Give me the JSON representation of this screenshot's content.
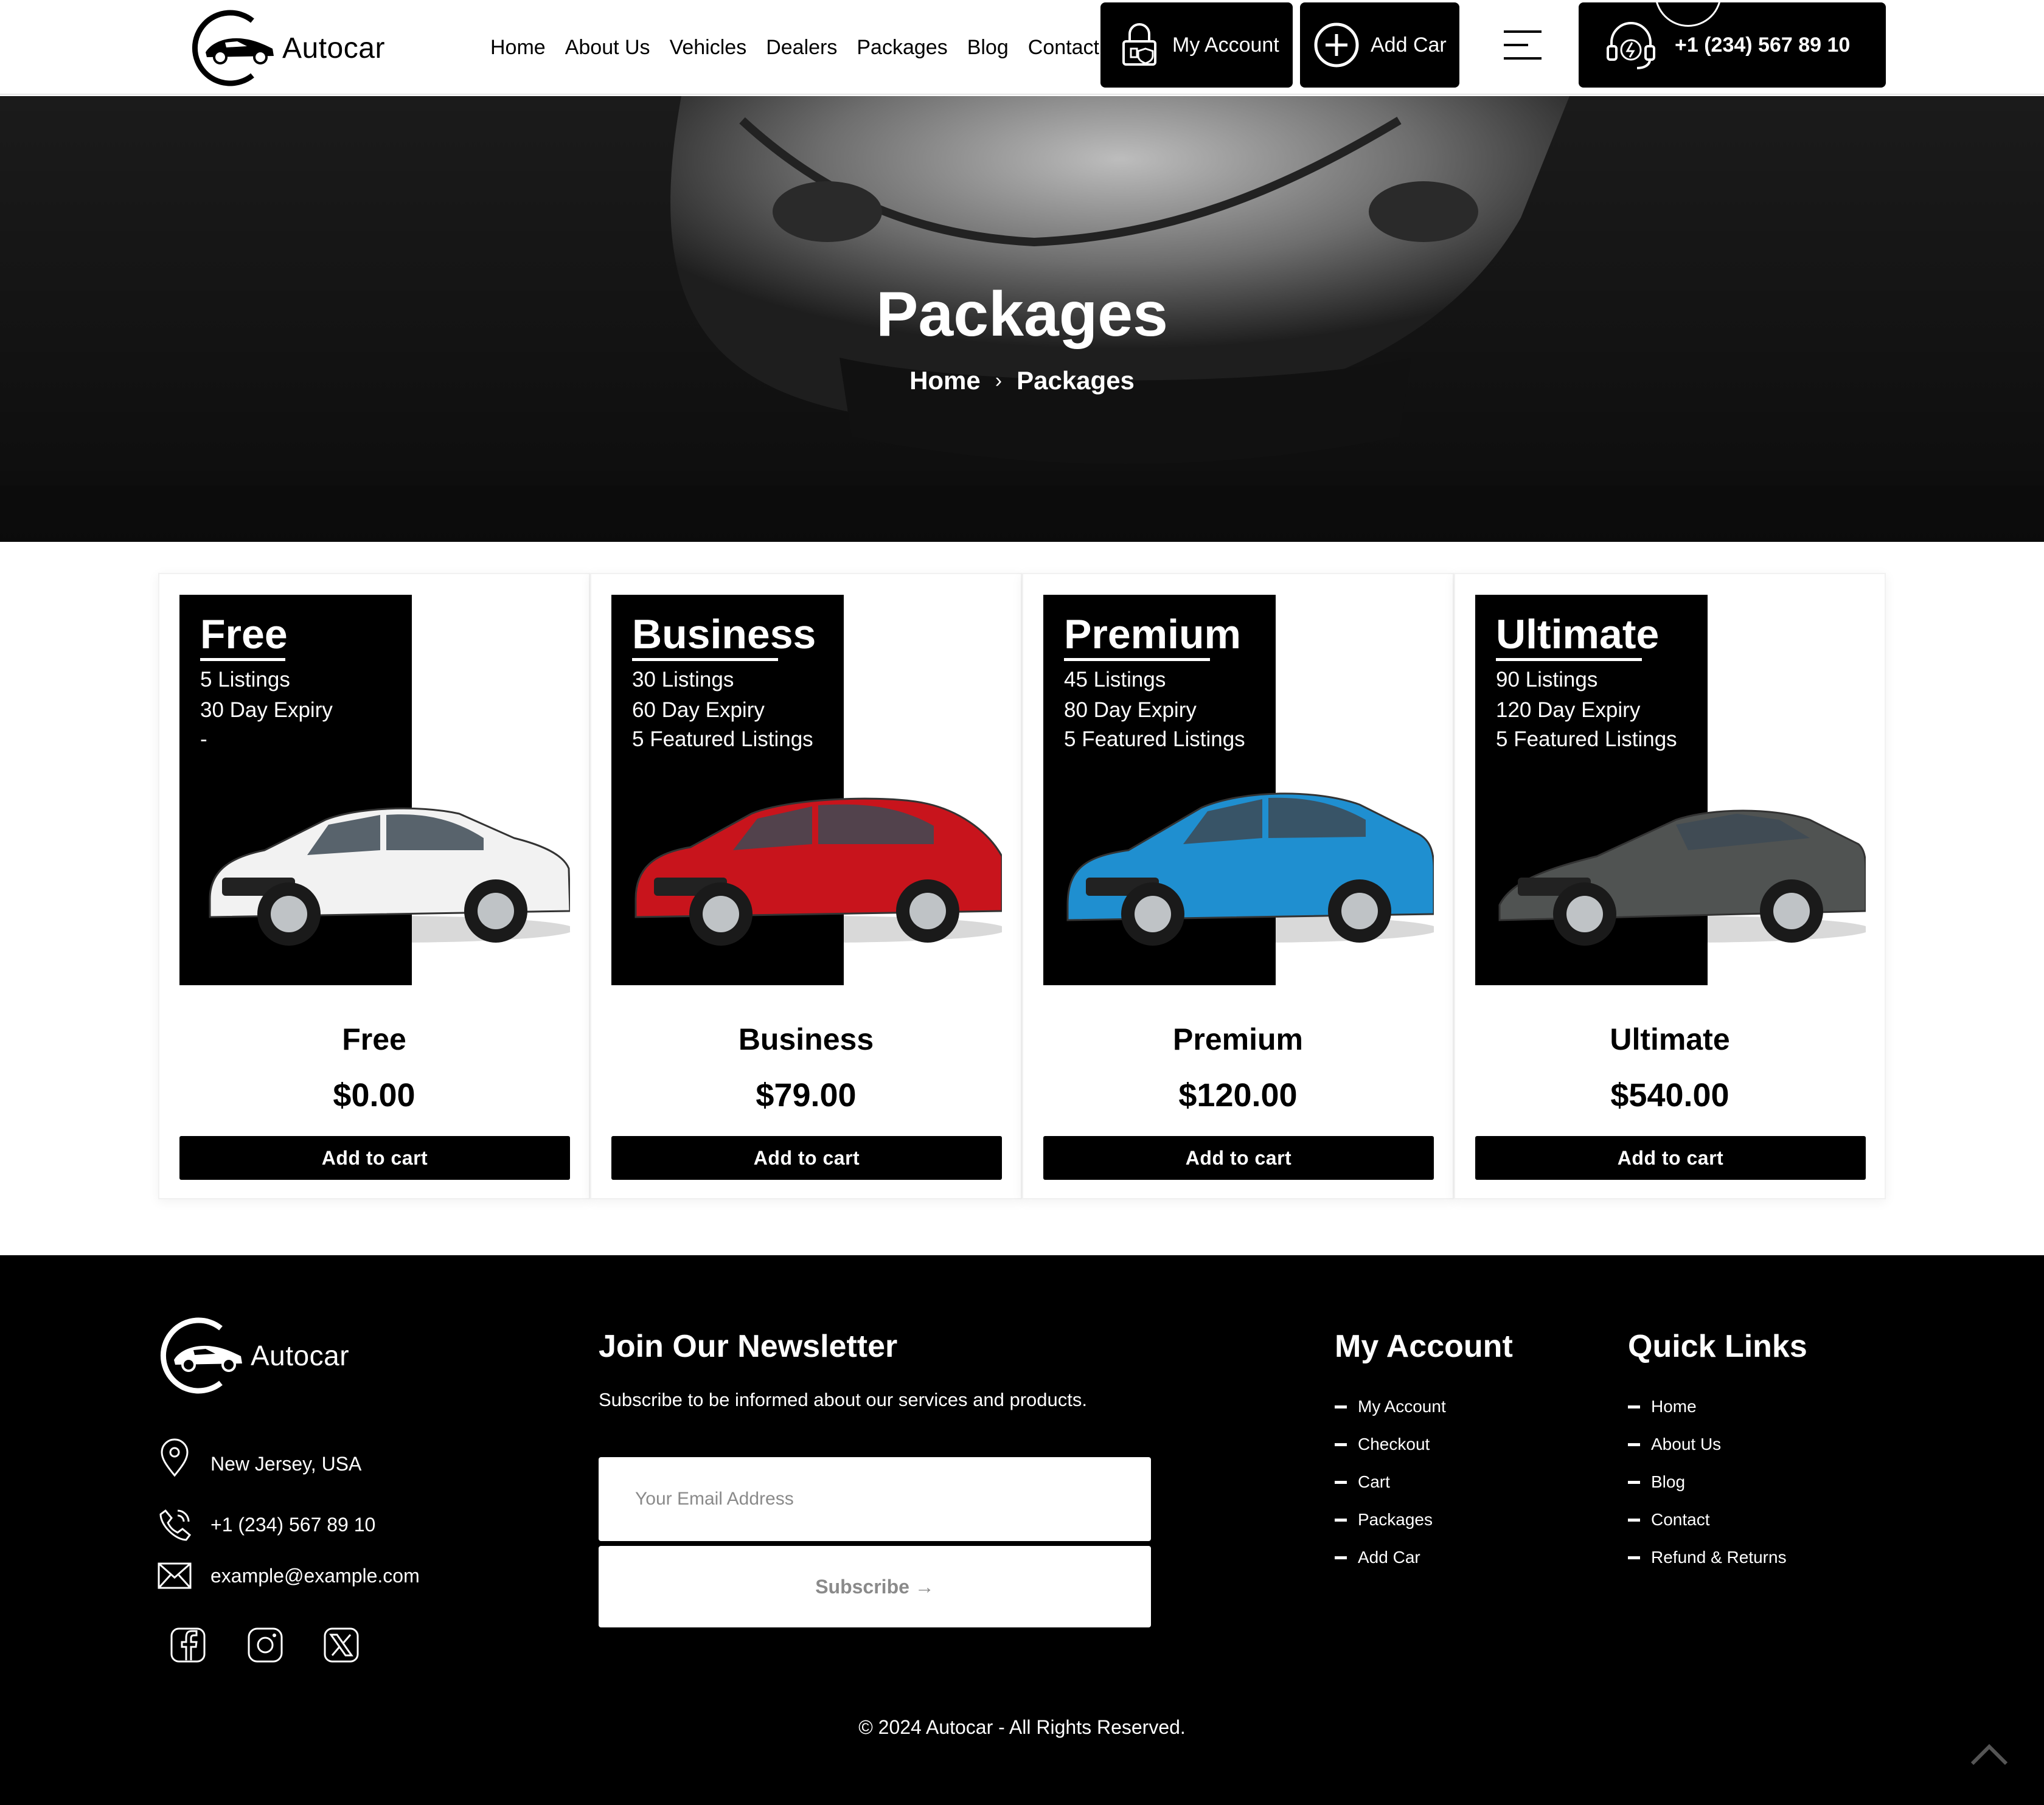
{
  "brand": {
    "name": "Autocar"
  },
  "nav": {
    "items": [
      "Home",
      "About Us",
      "Vehicles",
      "Dealers",
      "Packages",
      "Blog",
      "Contact"
    ],
    "account_label": "My Account",
    "add_car_label": "Add Car",
    "phone": "+1 (234) 567 89 10"
  },
  "hero": {
    "title": "Packages",
    "breadcrumb": {
      "home": "Home",
      "separator": "›",
      "current": "Packages"
    }
  },
  "packages": [
    {
      "headline": "Free",
      "features": [
        "5 Listings",
        "30 Day Expiry",
        "-"
      ],
      "name": "Free",
      "price": "$0.00",
      "button": "Add to cart",
      "car_color": "#f2f2f2",
      "car_type": "sedan"
    },
    {
      "headline": "Business",
      "features": [
        "30 Listings",
        "60 Day Expiry",
        "5 Featured Listings"
      ],
      "name": "Business",
      "price": "$79.00",
      "button": "Add to cart",
      "car_color": "#c8141c",
      "car_type": "hatch"
    },
    {
      "headline": "Premium",
      "features": [
        "45 Listings",
        "80 Day Expiry",
        "5 Featured Listings"
      ],
      "name": "Premium",
      "price": "$120.00",
      "button": "Add to cart",
      "car_color": "#1f8fd0",
      "car_type": "coupe"
    },
    {
      "headline": "Ultimate",
      "features": [
        "90 Listings",
        "120 Day Expiry",
        "5 Featured Listings"
      ],
      "name": "Ultimate",
      "price": "$540.00",
      "button": "Add to cart",
      "car_color": "#505352",
      "car_type": "super"
    }
  ],
  "footer": {
    "address": "New Jersey, USA",
    "phone": "+1 (234) 567 89 10",
    "email": "example@example.com",
    "socials": [
      "facebook-icon",
      "instagram-icon",
      "x-twitter-icon"
    ],
    "newsletter": {
      "title": "Join Our Newsletter",
      "subtitle": "Subscribe to be informed about our services and products.",
      "placeholder": "Your Email Address",
      "button": "Subscribe →"
    },
    "my_account": {
      "title": "My Account",
      "links": [
        "My Account",
        "Checkout",
        "Cart",
        "Packages",
        "Add Car"
      ]
    },
    "quick_links": {
      "title": "Quick Links",
      "links": [
        "Home",
        "About Us",
        "Blog",
        "Contact",
        "Refund & Returns"
      ]
    },
    "copyright": "© 2024 Autocar - All Rights Reserved."
  }
}
